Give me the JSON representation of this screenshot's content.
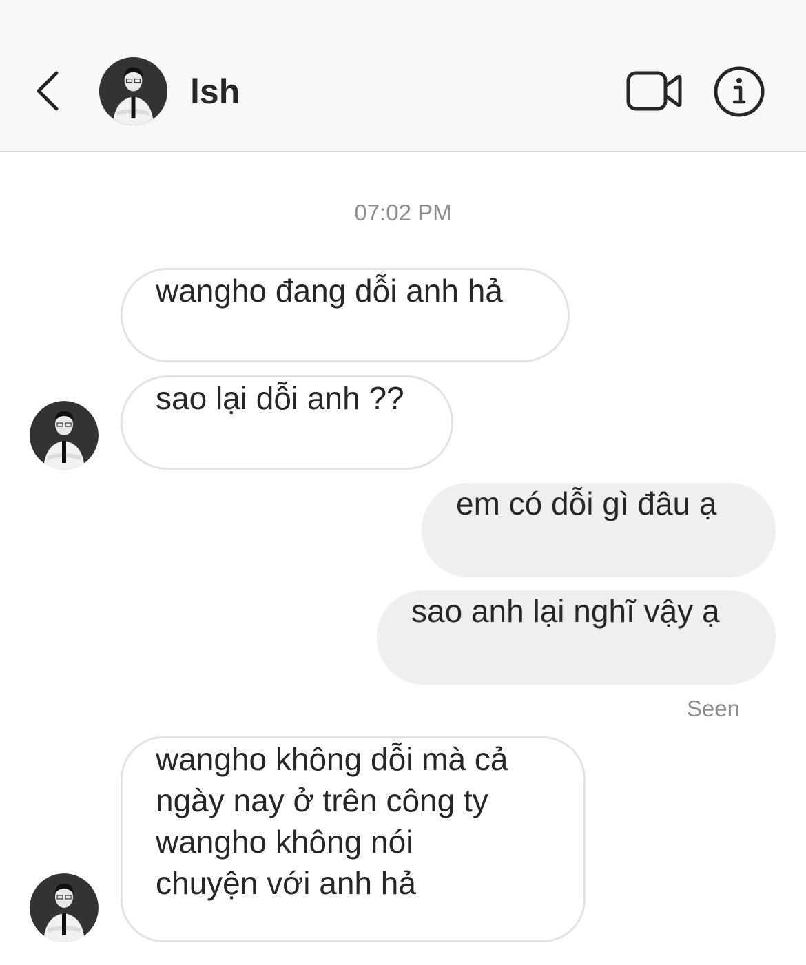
{
  "header": {
    "contact_name": "lsh",
    "back_icon": "chevron-left-icon",
    "video_icon": "video-camera-icon",
    "info_icon": "info-circle-icon"
  },
  "thread": {
    "timestamp": "07:02 PM",
    "messages": [
      {
        "sender": "them",
        "text": "wangho đang dỗi anh hả"
      },
      {
        "sender": "them",
        "text": "sao lại dỗi anh ??"
      },
      {
        "sender": "me",
        "text": "em có dỗi gì đâu ạ"
      },
      {
        "sender": "me",
        "text": "sao anh lại nghĩ vậy ạ"
      },
      {
        "sender": "them",
        "lines": [
          "wangho không dỗi mà cả",
          "ngày nay ở trên công ty",
          "wangho không nói",
          "chuyện với anh hả"
        ]
      }
    ],
    "seen_label": "Seen"
  },
  "colors": {
    "header_bg": "#f8f8f8",
    "incoming_border": "#e3e3e3",
    "outgoing_bg": "#efefef",
    "meta_text": "#8e8e8e",
    "text": "#262626"
  }
}
